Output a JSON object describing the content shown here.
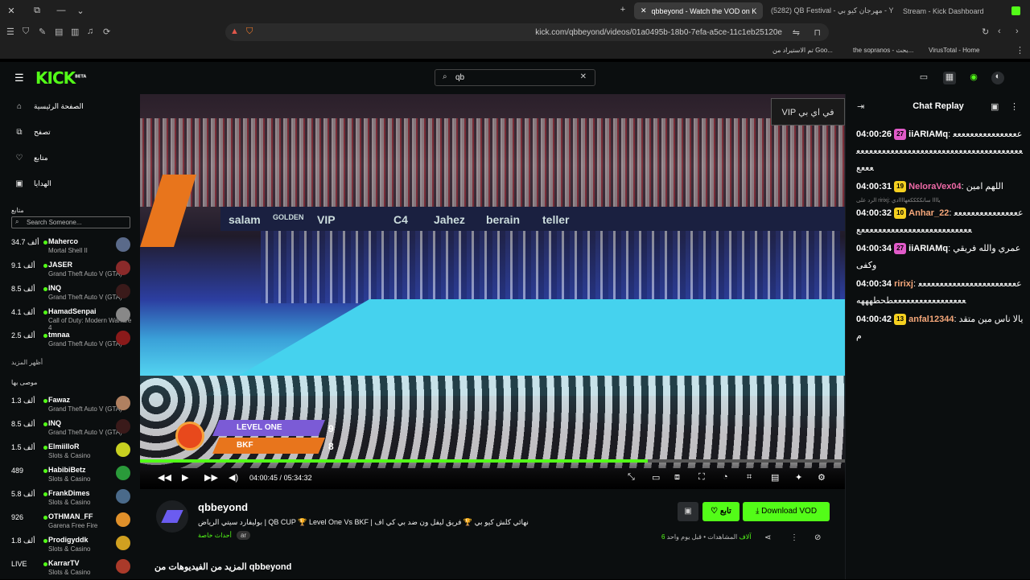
{
  "browser": {
    "tabs": [
      {
        "label": "qbbeyond - Watch the VOD on K",
        "active": true
      },
      {
        "label": "(5282) QB Festival - مهرجان كيو بي - Y",
        "active": false
      },
      {
        "label": "Stream - Kick Dashboard",
        "active": false
      }
    ],
    "url": "kick.com/qbbeyond/videos/01a0495b-18b0-7efa-a5ce-11c1eb25120e",
    "bookmarks": [
      "VirusTotal - Home",
      "the sopranos - بحث...",
      "تم الاستيراد من Goo..."
    ]
  },
  "header": {
    "logo": "KICK",
    "logo_badge": "BETA",
    "search_value": "qb"
  },
  "sidebar": {
    "nav": [
      {
        "label": "الصفحة الرئيسية",
        "icon": "home-icon",
        "glyph": "⌂"
      },
      {
        "label": "تصفح",
        "icon": "browse-icon",
        "glyph": "⧉"
      },
      {
        "label": "متابع",
        "icon": "heart-icon",
        "glyph": "♡"
      },
      {
        "label": "الهدايا",
        "icon": "gift-icon",
        "glyph": "▣"
      }
    ],
    "following_title": "متابع",
    "search_placeholder": "Search Someone...",
    "following": [
      {
        "name": "Maherco",
        "game": "Mortal Shell II",
        "viewers": "34.7 ألف",
        "color": "#5a6a8a"
      },
      {
        "name": "JASER",
        "game": "Grand Theft Auto V (GTA)",
        "viewers": "9.1 ألف",
        "color": "#8a2a2a"
      },
      {
        "name": "INQ",
        "game": "Grand Theft Auto V (GTA)",
        "viewers": "8.5 ألف",
        "color": "#3a1a1a"
      },
      {
        "name": "HamadSenpai",
        "game": "Call of Duty: Modern Warfare 4",
        "viewers": "4.1 ألف",
        "color": "#888888"
      },
      {
        "name": "tmnaa",
        "game": "Grand Theft Auto V (GTA)",
        "viewers": "2.5 ألف",
        "color": "#8a1a1a"
      }
    ],
    "show_more": "أظهر المزيد",
    "recommended_title": "موصى بها",
    "recommended": [
      {
        "name": "Fawaz",
        "game": "Grand Theft Auto V (GTA)",
        "viewers": "1.3 ألف",
        "color": "#b08060"
      },
      {
        "name": "INQ",
        "game": "Grand Theft Auto V (GTA)",
        "viewers": "8.5 ألف",
        "color": "#3a1a1a"
      },
      {
        "name": "ElmiilloR",
        "game": "Slots & Casino",
        "viewers": "1.5 ألف",
        "color": "#c8d020"
      },
      {
        "name": "HabibiBetz",
        "game": "Slots & Casino",
        "viewers": "489",
        "color": "#2a9a3a"
      },
      {
        "name": "FrankDimes",
        "game": "Slots & Casino",
        "viewers": "5.8 ألف",
        "color": "#4a6a8a"
      },
      {
        "name": "OTHMAN_FF",
        "game": "Garena Free Fire",
        "viewers": "926",
        "color": "#e0902a"
      },
      {
        "name": "Prodigyddk",
        "game": "Slots & Casino",
        "viewers": "1.8 ألف",
        "color": "#d0a020"
      },
      {
        "name": "KarrarTV",
        "game": "Slots & Casino",
        "viewers": "LIVE",
        "color": "#aa3a2a"
      }
    ]
  },
  "video": {
    "scoreboard": {
      "team1": "LEVEL ONE",
      "score1": "9",
      "team2": "BKF",
      "score2": "8"
    },
    "vip_label": "VIP في اي بي",
    "banner_words": [
      "salam",
      "GOLDEN",
      "VIP",
      "C4",
      "Jahez",
      "berain",
      "teller"
    ],
    "current_time": "04:00:45",
    "duration": "05:34:32",
    "progress_fraction": 0.72
  },
  "below": {
    "channel": "qbbeyond",
    "title": "بوليفارد سيتي الرياض | QB CUP 🏆 Level One Vs BKF | نهائي كلش كيو بي 🏆 فريق ليفل ون ضد بي كي اف",
    "category": "أحداث خاصة",
    "language": "ar",
    "follow_label": "تابع",
    "download_label": "Download VOD",
    "views": "6 آلاف",
    "views_label": "المشاهدات",
    "time_ago": "قبل يوم واحد",
    "more_videos": "المزيد من الفيديوهات من qbbeyond"
  },
  "chat": {
    "title": "Chat Replay",
    "messages": [
      {
        "time": "04:00:26",
        "badge": "27",
        "badge_color": "#e05ac8",
        "user": "iiARIAMq",
        "user_color": "#ffffff",
        "text": "ععععععععععععععععععععععععععععععععععععععععععععععععععععععععععع"
      },
      {
        "time": "04:00:31",
        "badge": "19",
        "badge_color": "#f5d020",
        "user": "NeloraVex04",
        "user_color": "#f06aa8",
        "text": "اللهم امين"
      },
      {
        "time": "04:00:32",
        "badge": "10",
        "badge_color": "#f5d020",
        "user": "Anhar_22",
        "user_color": "#f5a77a",
        "text": "ععععععععععععععععععععععععععععععععععععععععععع",
        "reply": "الرد على ririxj: ياااا ساتككككعهاااادي"
      },
      {
        "time": "04:00:34",
        "badge": "27",
        "badge_color": "#e05ac8",
        "user": "iiARIAMq",
        "user_color": "#ffffff",
        "text": "عمري والله فريقي وكفى"
      },
      {
        "time": "04:00:34",
        "badge": "",
        "badge_color": "",
        "user": "ririxj",
        "user_color": "#f5a77a",
        "text": "عععععععععععععععععععععععععععععععععععععععععطحطهههه"
      },
      {
        "time": "04:00:42",
        "badge": "13",
        "badge_color": "#f5d020",
        "user": "anfal12344",
        "user_color": "#f5a77a",
        "text": "يالا ناس مين متقدم"
      }
    ]
  }
}
